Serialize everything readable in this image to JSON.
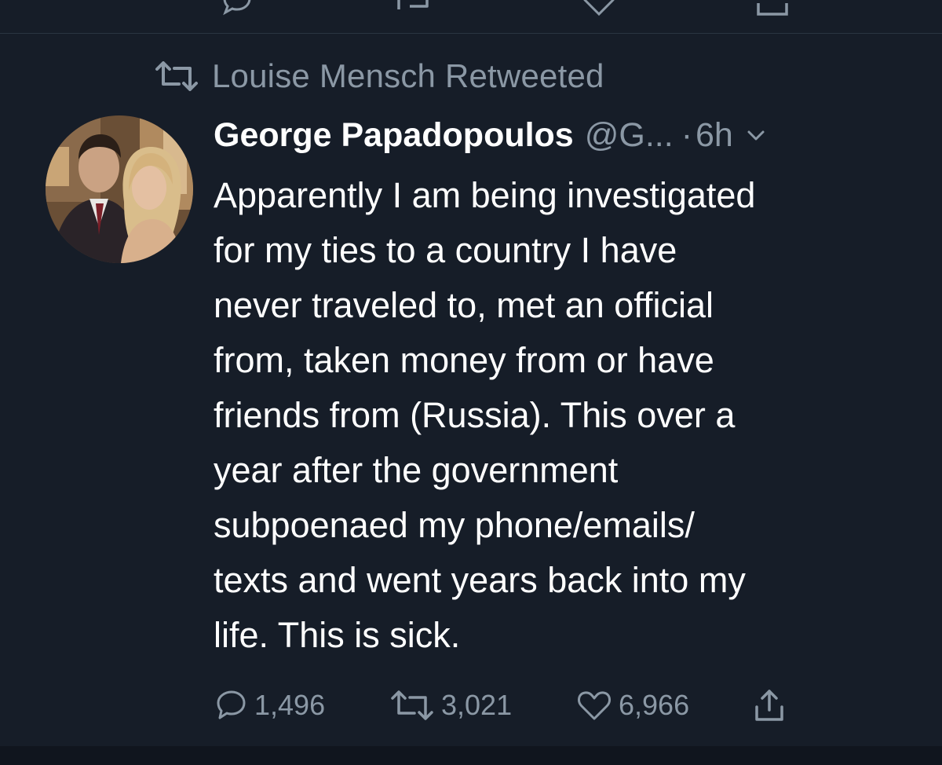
{
  "retweet_context": {
    "icon": "retweet-icon",
    "label": "Louise Mensch Retweeted"
  },
  "tweet": {
    "author": {
      "display_name": "George Papadopoulos",
      "handle": "@G...",
      "avatar": "profile-photo"
    },
    "separator": "·",
    "time": "6h",
    "text_lines": [
      "Apparently I am being investigated",
      "for my ties to a country I have",
      "never traveled to, met an official",
      "from, taken money from or have",
      "friends from (Russia). This over a",
      "year after the government",
      "subpoenaed my phone/emails/",
      "texts and went years back into my",
      "life. This is sick."
    ],
    "stats": {
      "replies": "1,496",
      "retweets": "3,021",
      "likes": "6,966"
    }
  },
  "colors": {
    "background": "#161d28",
    "text": "#ffffff",
    "secondary": "#8b98a5",
    "divider": "#2a3441"
  }
}
